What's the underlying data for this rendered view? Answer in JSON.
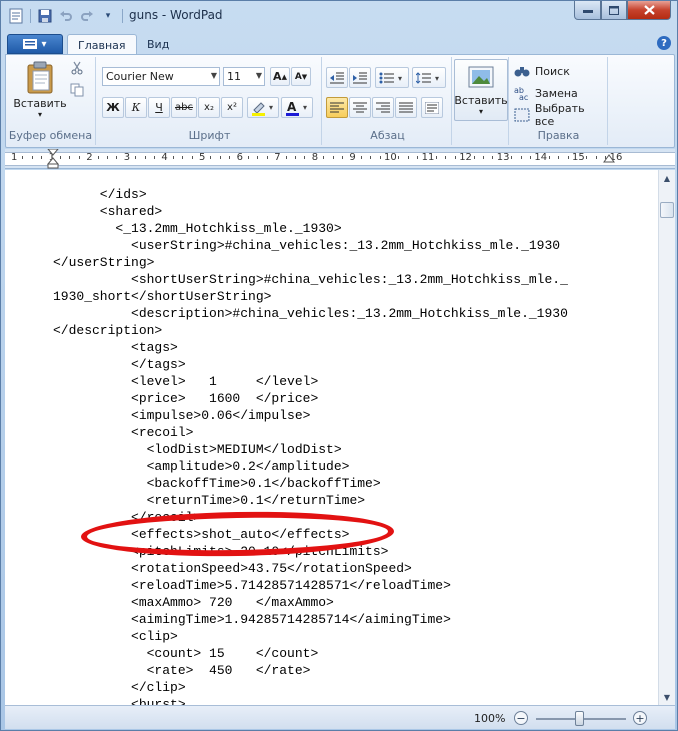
{
  "window": {
    "title": "guns - WordPad"
  },
  "ribbon": {
    "tabs": [
      {
        "label": "Главная"
      },
      {
        "label": "Вид"
      }
    ],
    "clipboard": {
      "paste_label": "Вставить",
      "group_label": "Буфер обмена"
    },
    "font": {
      "family": "Courier New",
      "size": "11",
      "group_label": "Шрифт",
      "bold": "Ж",
      "italic": "К",
      "underline": "Ч",
      "strike": "abc",
      "subscript": "x₂",
      "superscript": "x²"
    },
    "paragraph": {
      "group_label": "Абзац"
    },
    "insert": {
      "label": "Вставить"
    },
    "editing": {
      "group_label": "Правка",
      "find": "Поиск",
      "replace": "Замена",
      "select_all": "Выбрать все"
    }
  },
  "ruler": {
    "ticks": [
      "1",
      "1",
      "2",
      "3",
      "4",
      "5",
      "6",
      "7",
      "8",
      "9",
      "10",
      "11",
      "12",
      "13",
      "14",
      "15",
      "16"
    ]
  },
  "document": {
    "lines": [
      "      </ids>",
      "      <shared>",
      "        <_13.2mm_Hotchkiss_mle._1930>",
      "          <userString>#china_vehicles:_13.2mm_Hotchkiss_mle._1930",
      "</userString>",
      "          <shortUserString>#china_vehicles:_13.2mm_Hotchkiss_mle._",
      "1930_short</shortUserString>",
      "          <description>#china_vehicles:_13.2mm_Hotchkiss_mle._1930",
      "</description>",
      "          <tags>",
      "          </tags>",
      "          <level>   1     </level>",
      "          <price>   1600  </price>",
      "          <impulse>0.06</impulse>",
      "          <recoil>",
      "            <lodDist>MEDIUM</lodDist>",
      "            <amplitude>0.2</amplitude>",
      "            <backoffTime>0.1</backoffTime>",
      "            <returnTime>0.1</returnTime>",
      "          </recoil>",
      "          <effects>shot_auto</effects>",
      "          <pitchLimits>-20 10</pitchLimits>",
      "          <rotationSpeed>43.75</rotationSpeed>",
      "          <reloadTime>5.71428571428571</reloadTime>",
      "          <maxAmmo> 720   </maxAmmo>",
      "          <aimingTime>1.94285714285714</aimingTime>",
      "          <clip>",
      "            <count> 15    </count>",
      "            <rate>  450   </rate>",
      "          </clip>",
      "          <burst>"
    ]
  },
  "status": {
    "zoom": "100%",
    "zoom_level_percent": 100
  }
}
